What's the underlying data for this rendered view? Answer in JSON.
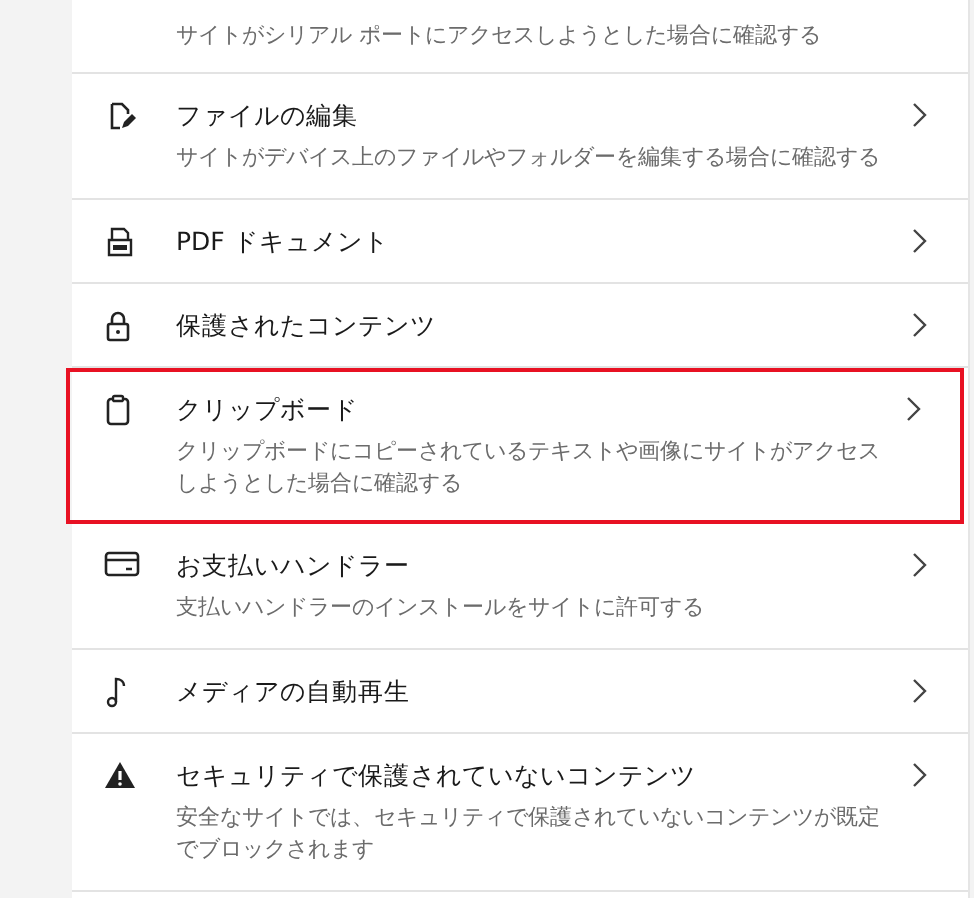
{
  "items": [
    {
      "kind": "partial",
      "description": "サイトがシリアル ポートにアクセスしようとした場合に確認する",
      "selected": false
    },
    {
      "kind": "file-edit",
      "title": "ファイルの編集",
      "description": "サイトがデバイス上のファイルやフォルダーを編集する場合に確認する",
      "selected": false
    },
    {
      "kind": "pdf",
      "title": "PDF ドキュメント",
      "selected": false
    },
    {
      "kind": "lock",
      "title": "保護されたコンテンツ",
      "selected": false
    },
    {
      "kind": "clipboard",
      "title": "クリップボード",
      "description": "クリップボードにコピーされているテキストや画像にサイトがアクセスしようとした場合に確認する",
      "selected": true
    },
    {
      "kind": "card",
      "title": "お支払いハンドラー",
      "description": "支払いハンドラーのインストールをサイトに許可する",
      "selected": false
    },
    {
      "kind": "music",
      "title": "メディアの自動再生",
      "selected": false
    },
    {
      "kind": "warning",
      "title": "セキュリティで保護されていないコンテンツ",
      "description": "安全なサイトでは、セキュリティで保護されていないコンテンツが既定でブロックされます",
      "selected": false
    }
  ]
}
